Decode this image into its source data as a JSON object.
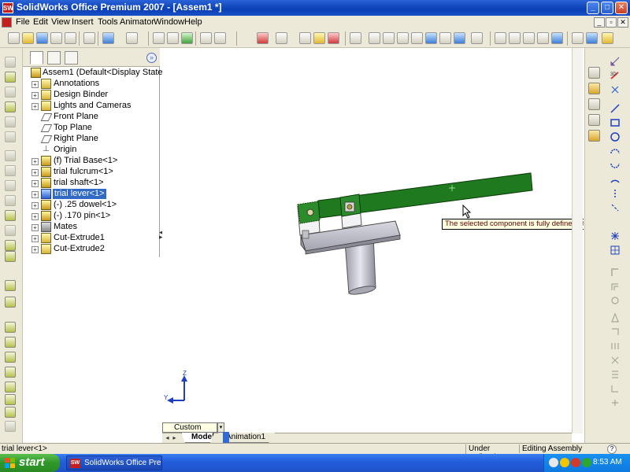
{
  "window": {
    "title": "SolidWorks Office Premium 2007 - [Assem1 *]",
    "app_icon_text": "SW",
    "minimize": "_",
    "maximize": "□",
    "close": "✕"
  },
  "menu": {
    "items": [
      "File",
      "Edit",
      "View",
      "Insert",
      "Tools",
      "Animator",
      "Window",
      "Help"
    ],
    "mdi_minimize": "_",
    "mdi_restore": "▫",
    "mdi_close": "✕"
  },
  "feature_manager": {
    "expand_label": "»",
    "root": "Assem1  (Default<Display State-1>)",
    "items": [
      {
        "label": "Annotations",
        "icon": "annotations-icon",
        "expander": "+"
      },
      {
        "label": "Design Binder",
        "icon": "design-binder-icon",
        "expander": "+"
      },
      {
        "label": "Lights and Cameras",
        "icon": "lights-cameras-icon",
        "expander": "+"
      },
      {
        "label": "Front Plane",
        "icon": "plane-icon",
        "expander": ""
      },
      {
        "label": "Top Plane",
        "icon": "plane-icon",
        "expander": ""
      },
      {
        "label": "Right Plane",
        "icon": "plane-icon",
        "expander": ""
      },
      {
        "label": "Origin",
        "icon": "origin-icon",
        "expander": ""
      },
      {
        "label": "(f) Trial Base<1>",
        "icon": "part-icon",
        "expander": "+"
      },
      {
        "label": "trial fulcrum<1>",
        "icon": "part-icon",
        "expander": "+"
      },
      {
        "label": "trial shaft<1>",
        "icon": "part-icon",
        "expander": "+"
      },
      {
        "label": "trial lever<1>",
        "icon": "part-icon",
        "expander": "+",
        "selected": true
      },
      {
        "label": "(-) .25 dowel<1>",
        "icon": "part-icon",
        "expander": "+"
      },
      {
        "label": "(-) .170 pin<1>",
        "icon": "part-icon",
        "expander": "+"
      },
      {
        "label": "Mates",
        "icon": "mates-icon",
        "expander": "+"
      },
      {
        "label": "Cut-Extrude1",
        "icon": "cut-extrude-icon",
        "expander": "+"
      },
      {
        "label": "Cut-Extrude2",
        "icon": "cut-extrude-icon",
        "expander": "+"
      }
    ]
  },
  "viewport": {
    "tooltip": "The selected component is fully defined.  It cannot be moved.",
    "triad_y": "Y",
    "triad_z": "Z"
  },
  "bottom_tabs": {
    "custom": "Custom",
    "dropdown": "▾",
    "model": "Model",
    "animation": "Animation1",
    "nav_first": "◂",
    "nav_last": "▸"
  },
  "status": {
    "selection": "trial lever<1>",
    "defined": "Under Defined",
    "mode": "Editing Assembly",
    "help": "?"
  },
  "taskbar": {
    "start": "start",
    "task_item": "SolidWorks Office Pre...",
    "task_icon_text": "SW",
    "clock": "8:53 AM"
  },
  "colors": {
    "lever_green": "#1f7a1f",
    "selection_blue": "#316ac5",
    "tooltip_bg": "#ffffe1",
    "titlebar_blue": "#0a3fb5"
  }
}
